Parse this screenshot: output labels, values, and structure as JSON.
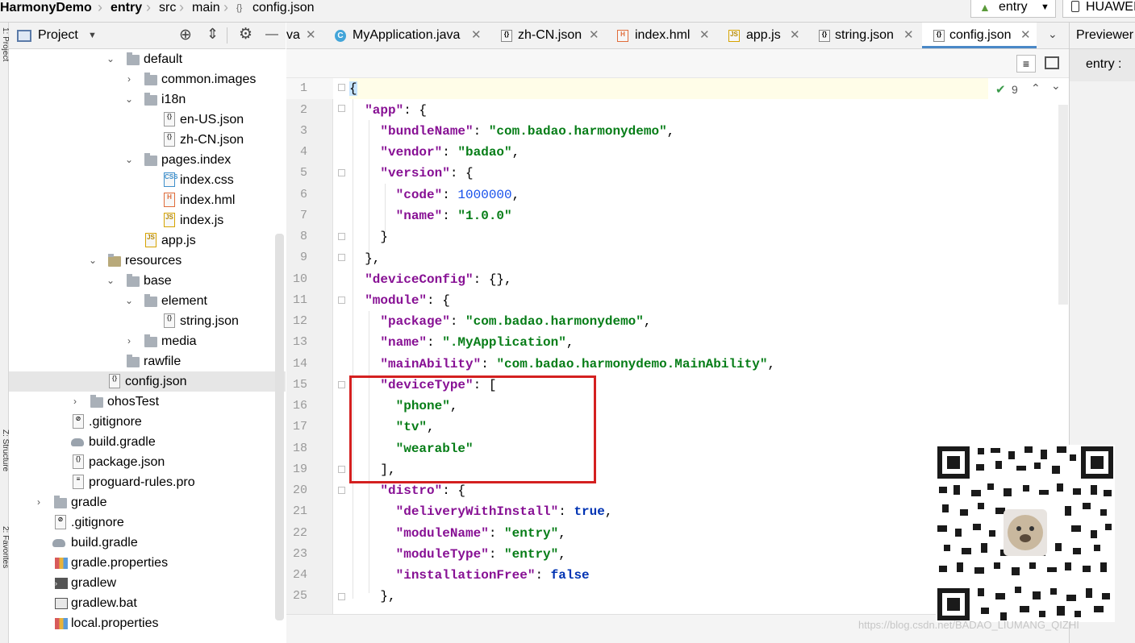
{
  "breadcrumb": {
    "items": [
      "HarmonyDemo",
      "entry",
      "src",
      "main",
      "config.json"
    ],
    "run_config": "entry",
    "device": "HUAWEI"
  },
  "side_tools": {
    "project": "1: Project",
    "structure": "Z: Structure",
    "favorites": "2: Favorites"
  },
  "project_panel": {
    "title": "Project",
    "tree": [
      {
        "label": "default",
        "type": "folder",
        "expanded": true
      },
      {
        "label": "common.images",
        "type": "folder",
        "expanded": false
      },
      {
        "label": "i18n",
        "type": "folder",
        "expanded": true
      },
      {
        "label": "en-US.json",
        "type": "json"
      },
      {
        "label": "zh-CN.json",
        "type": "json"
      },
      {
        "label": "pages.index",
        "type": "folder",
        "expanded": true
      },
      {
        "label": "index.css",
        "type": "css"
      },
      {
        "label": "index.hml",
        "type": "hml"
      },
      {
        "label": "index.js",
        "type": "js"
      },
      {
        "label": "app.js",
        "type": "js"
      },
      {
        "label": "resources",
        "type": "folder",
        "expanded": true
      },
      {
        "label": "base",
        "type": "folder",
        "expanded": true
      },
      {
        "label": "element",
        "type": "folder",
        "expanded": true
      },
      {
        "label": "string.json",
        "type": "json"
      },
      {
        "label": "media",
        "type": "folder",
        "expanded": false
      },
      {
        "label": "rawfile",
        "type": "folder"
      },
      {
        "label": "config.json",
        "type": "json",
        "selected": true
      },
      {
        "label": "ohosTest",
        "type": "folder",
        "expanded": false
      },
      {
        "label": ".gitignore",
        "type": "git"
      },
      {
        "label": "build.gradle",
        "type": "gradle"
      },
      {
        "label": "package.json",
        "type": "json"
      },
      {
        "label": "proguard-rules.pro",
        "type": "file"
      },
      {
        "label": "gradle",
        "type": "folder",
        "expanded": false
      },
      {
        "label": ".gitignore",
        "type": "git"
      },
      {
        "label": "build.gradle",
        "type": "gradle"
      },
      {
        "label": "gradle.properties",
        "type": "props"
      },
      {
        "label": "gradlew",
        "type": "term"
      },
      {
        "label": "gradlew.bat",
        "type": "bat"
      },
      {
        "label": "local.properties",
        "type": "props"
      }
    ]
  },
  "tabs": [
    {
      "label": "va",
      "icon": ""
    },
    {
      "label": "MyApplication.java",
      "icon": "C"
    },
    {
      "label": "zh-CN.json",
      "icon": "{}"
    },
    {
      "label": "index.hml",
      "icon": "H"
    },
    {
      "label": "app.js",
      "icon": "JS"
    },
    {
      "label": "string.json",
      "icon": "{}"
    },
    {
      "label": "config.json",
      "icon": "{}",
      "active": true
    }
  ],
  "editor": {
    "inspection_count": "9",
    "line_numbers": [
      "1",
      "2",
      "3",
      "4",
      "5",
      "6",
      "7",
      "8",
      "9",
      "10",
      "11",
      "12",
      "13",
      "14",
      "15",
      "16",
      "17",
      "18",
      "19",
      "20",
      "21",
      "22",
      "23",
      "24",
      "25"
    ]
  },
  "previewer": {
    "title": "Previewer",
    "content": "entry :"
  },
  "watermark": "https://blog.csdn.net/BADAO_LIUMANG_QIZHI",
  "colors": {
    "key": "#871094",
    "string": "#067d17",
    "number": "#1750eb",
    "keyword": "#0033b3",
    "highlight_box": "#d42020",
    "active_tab_underline": "#4a88c7"
  }
}
